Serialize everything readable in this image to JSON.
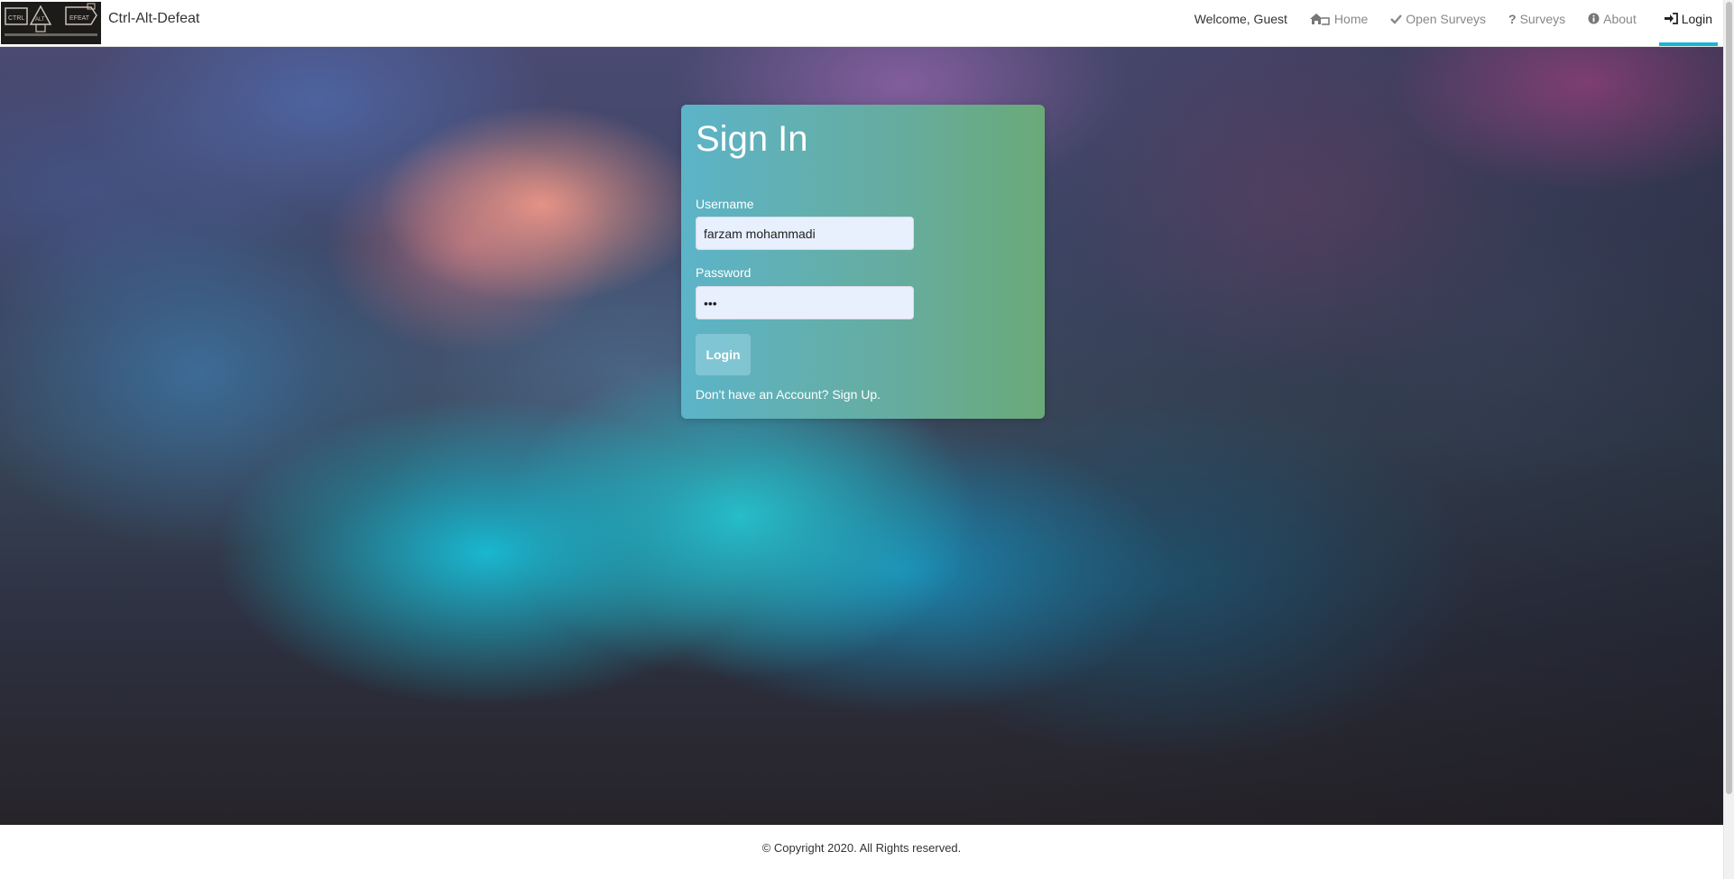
{
  "nav": {
    "logo_text_top": "CTRL ALT DEFEAT",
    "logo_text_ctrl": "CTRL",
    "logo_text_alt": "ALT",
    "logo_text_defeat": "EFEAT",
    "brand": "Ctrl-Alt-Defeat",
    "welcome": "Welcome, Guest",
    "links": [
      {
        "label": "Home",
        "icon": "home-icon"
      },
      {
        "label": "Open Surveys",
        "icon": "check-icon"
      },
      {
        "label": "Surveys",
        "icon": "question-icon"
      },
      {
        "label": "About",
        "icon": "info-icon"
      },
      {
        "label": "Login",
        "icon": "sign-in-icon",
        "active": true
      }
    ]
  },
  "signin": {
    "title": "Sign In",
    "username_label": "Username",
    "username_value": "farzam mohammadi",
    "password_label": "Password",
    "password_value": "•••",
    "login_button": "Login",
    "signup_prompt": "Don't have an Account? Sign Up."
  },
  "footer": {
    "copyright": "© Copyright 2020. All Rights reserved."
  },
  "colors": {
    "accent": "#17b5d6",
    "card_left": "#5cb4c8",
    "card_right": "#6aaa78",
    "input_bg": "#e8f0fe"
  }
}
